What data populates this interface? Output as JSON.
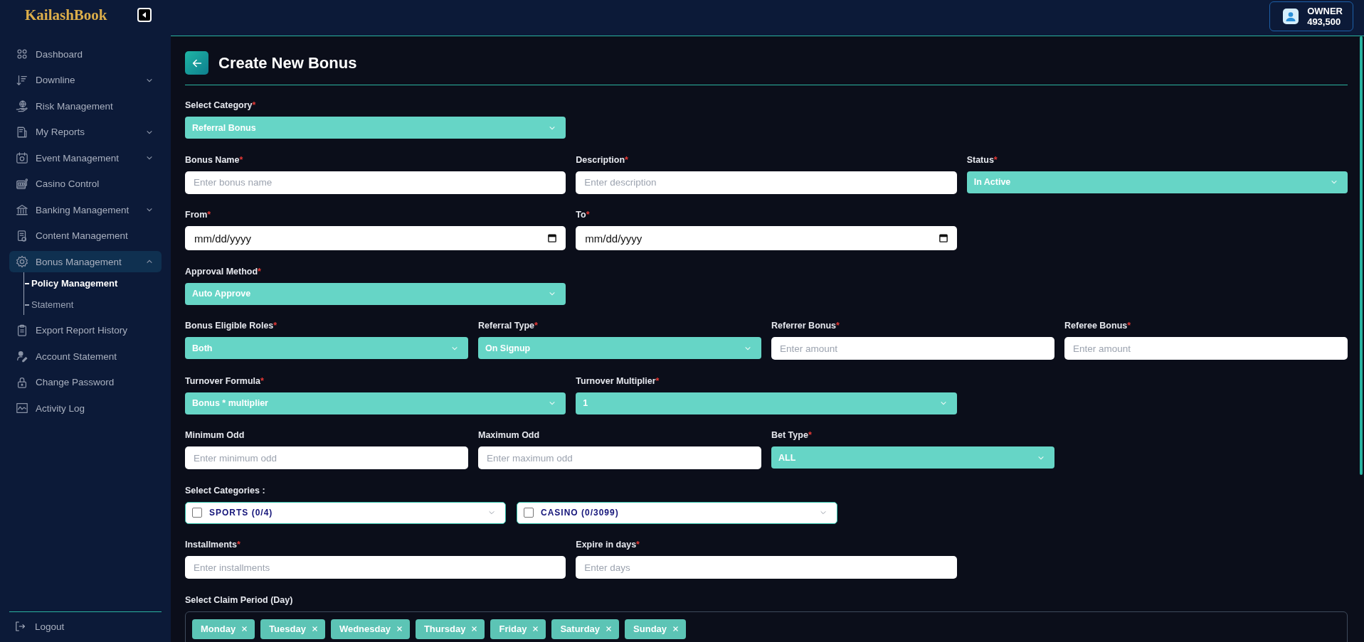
{
  "sidebar": {
    "logo": "KailashBook",
    "items": [
      {
        "label": "Dashboard",
        "kind": "link",
        "selected": false
      },
      {
        "label": "Downline",
        "kind": "group",
        "expanded": false,
        "selected": false
      },
      {
        "label": "Risk Management",
        "kind": "link",
        "selected": false
      },
      {
        "label": "My Reports",
        "kind": "group",
        "expanded": false,
        "selected": false
      },
      {
        "label": "Event Management",
        "kind": "group",
        "expanded": false,
        "selected": false
      },
      {
        "label": "Casino Control",
        "kind": "link",
        "selected": false
      },
      {
        "label": "Banking Management",
        "kind": "group",
        "expanded": false,
        "selected": false
      },
      {
        "label": "Content Management",
        "kind": "link",
        "selected": false
      },
      {
        "label": "Bonus Management",
        "kind": "group",
        "expanded": true,
        "selected": true,
        "children": [
          {
            "label": "Policy Management",
            "selected": true
          },
          {
            "label": "Statement",
            "selected": false
          }
        ]
      },
      {
        "label": "Export Report History",
        "kind": "link",
        "selected": false
      },
      {
        "label": "Account Statement",
        "kind": "link",
        "selected": false
      },
      {
        "label": "Change Password",
        "kind": "link",
        "selected": false
      },
      {
        "label": "Activity Log",
        "kind": "link",
        "selected": false
      }
    ],
    "logout": "Logout"
  },
  "header": {
    "user": {
      "role": "OWNER",
      "balance": "493,500"
    }
  },
  "page": {
    "title": "Create New Bonus"
  },
  "form": {
    "rows": [
      {
        "fields": [
          {
            "kind": "select",
            "label": "Select Category",
            "mark": "*",
            "value": "Referral Bonus"
          }
        ]
      },
      {
        "fields": [
          {
            "kind": "text",
            "label": "Bonus Name",
            "mark": "*",
            "placeholder": "Enter bonus name"
          },
          {
            "kind": "text",
            "label": "Description",
            "mark": "*",
            "placeholder": "Enter description"
          },
          {
            "kind": "select",
            "label": "Status",
            "mark": "*",
            "value": "In Active"
          }
        ]
      },
      {
        "fields": [
          {
            "kind": "date",
            "label": "From",
            "mark": "*",
            "placeholder": "mm/dd/yyyy"
          },
          {
            "kind": "date",
            "label": "To",
            "mark": "*",
            "placeholder": "mm/dd/yyyy"
          }
        ]
      },
      {
        "fields": [
          {
            "kind": "select",
            "label": "Approval Method",
            "mark": "*",
            "value": "Auto Approve"
          }
        ]
      },
      {
        "fields": [
          {
            "kind": "select",
            "label": "Bonus Eligible Roles",
            "mark": "*",
            "value": "Both"
          },
          {
            "kind": "select",
            "label": "Referral Type",
            "mark": "*",
            "value": "On Signup"
          },
          {
            "kind": "text",
            "label": "Referrer Bonus",
            "mark": "*",
            "placeholder": "Enter amount"
          },
          {
            "kind": "text",
            "label": "Referee Bonus",
            "mark": "*",
            "placeholder": "Enter amount"
          }
        ]
      },
      {
        "fields": [
          {
            "kind": "select",
            "label": "Turnover Formula",
            "mark": "*",
            "value": "Bonus * multiplier"
          },
          {
            "kind": "select",
            "label": "Turnover Multiplier",
            "mark": "*",
            "value": "1"
          }
        ]
      },
      {
        "fields": [
          {
            "kind": "text",
            "label": "Minimum Odd",
            "placeholder": "Enter minimum odd"
          },
          {
            "kind": "text",
            "label": "Maximum Odd",
            "placeholder": "Enter maximum odd"
          },
          {
            "kind": "select",
            "label": "Bet Type",
            "mark": "*",
            "value": "ALL"
          }
        ]
      },
      {
        "fields": [
          {
            "kind": "categories",
            "label": "Select Categories :",
            "options": [
              {
                "label": "SPORTS (0/4)",
                "checked": false
              },
              {
                "label": "CASINO (0/3099)",
                "checked": false
              }
            ]
          }
        ]
      },
      {
        "fields": [
          {
            "kind": "text",
            "label": "Installments",
            "mark": "*",
            "placeholder": "Enter installments"
          },
          {
            "kind": "text",
            "label": "Expire in days",
            "mark": "*",
            "placeholder": "Enter days"
          }
        ]
      },
      {
        "fields": [
          {
            "kind": "chips",
            "label": "Select Claim Period (Day)",
            "chips": [
              "Monday",
              "Tuesday",
              "Wednesday",
              "Thursday",
              "Friday",
              "Saturday",
              "Sunday"
            ]
          }
        ]
      }
    ]
  }
}
